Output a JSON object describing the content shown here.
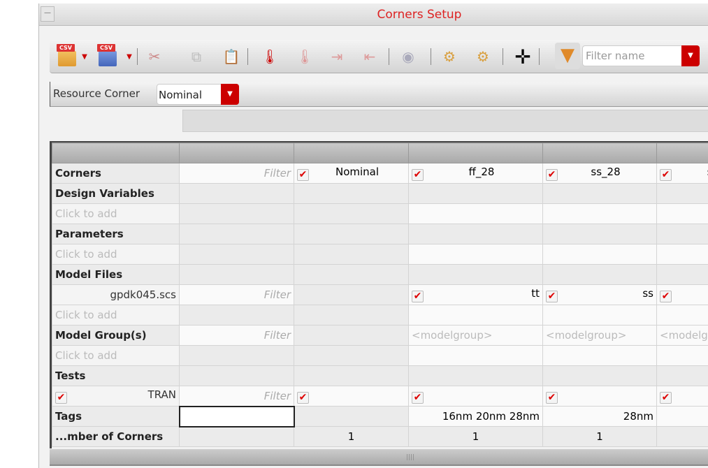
{
  "window": {
    "title": "Corners Setup",
    "menu_icon": "—"
  },
  "toolbar": {
    "filter_placeholder": "Filter name",
    "csv": "CSV"
  },
  "resource_corner": {
    "label": "Resource Corner",
    "value": "Nominal"
  },
  "table": {
    "rows": [
      {
        "type": "title",
        "label": "Corners",
        "cells": [
          {
            "filter": "Filter"
          },
          {
            "check": true,
            "text": "Nominal",
            "align": "c"
          },
          {
            "check": true,
            "text": "ff_28",
            "align": "c"
          },
          {
            "check": true,
            "text": "ss_28",
            "align": "c"
          },
          {
            "check": true,
            "text": "s",
            "align": "c"
          }
        ]
      },
      {
        "type": "bold",
        "label": "Design Variables",
        "cells": [
          {},
          {},
          {},
          {},
          {}
        ]
      },
      {
        "type": "ph",
        "label": "Click to add",
        "cells": [
          {},
          {},
          {
            "white": true
          },
          {
            "white": true
          },
          {
            "white": true
          }
        ]
      },
      {
        "type": "bold",
        "label": "Parameters",
        "cells": [
          {},
          {},
          {},
          {},
          {}
        ]
      },
      {
        "type": "ph",
        "label": "Click to add",
        "cells": [
          {},
          {},
          {
            "white": true
          },
          {
            "white": true
          },
          {
            "white": true
          }
        ]
      },
      {
        "type": "bold",
        "label": "Model Files",
        "cells": [
          {},
          {},
          {},
          {},
          {}
        ]
      },
      {
        "type": "item",
        "label": "gpdk045.scs",
        "cells": [
          {
            "filter": "Filter"
          },
          {},
          {
            "check": true,
            "text": "tt",
            "align": "r",
            "white": true
          },
          {
            "check": true,
            "text": "ss",
            "align": "r",
            "white": true
          },
          {
            "check": true,
            "white": true
          }
        ]
      },
      {
        "type": "ph",
        "label": "Click to add",
        "cells": [
          {},
          {},
          {
            "white": true
          },
          {
            "white": true
          },
          {
            "white": true
          }
        ]
      },
      {
        "type": "bold",
        "label": "Model Group(s)",
        "cells": [
          {
            "filter": "Filter"
          },
          {},
          {
            "text": "<modelgroup>",
            "ph": true,
            "white": true
          },
          {
            "text": "<modelgroup>",
            "ph": true,
            "white": true
          },
          {
            "text": "<modelgroup>",
            "ph": true,
            "white": true
          }
        ]
      },
      {
        "type": "ph",
        "label": "Click to add",
        "cells": [
          {},
          {},
          {
            "white": true
          },
          {
            "white": true
          },
          {
            "white": true
          }
        ]
      },
      {
        "type": "bold",
        "label": "Tests",
        "cells": [
          {},
          {},
          {},
          {},
          {}
        ]
      },
      {
        "type": "item",
        "label": "TRAN",
        "check": true,
        "cells": [
          {
            "filter": "Filter"
          },
          {
            "check": true,
            "white": true
          },
          {
            "check": true,
            "white": true
          },
          {
            "check": true,
            "white": true
          },
          {
            "check": true,
            "white": true
          }
        ]
      },
      {
        "type": "bold",
        "label": "Tags",
        "cells": [
          {
            "edit": true
          },
          {},
          {
            "text": "16nm 20nm 28nm",
            "align": "r",
            "white": true
          },
          {
            "text": "28nm",
            "align": "r",
            "white": true
          },
          {
            "white": true
          }
        ]
      },
      {
        "type": "bold",
        "label": "...mber of Corners",
        "cells": [
          {},
          {
            "text": "1",
            "align": "c"
          },
          {
            "text": "1",
            "align": "c"
          },
          {
            "text": "1",
            "align": "c"
          },
          {}
        ]
      }
    ]
  },
  "colors": {
    "accent": "#cc0000",
    "title": "#dd2222"
  }
}
